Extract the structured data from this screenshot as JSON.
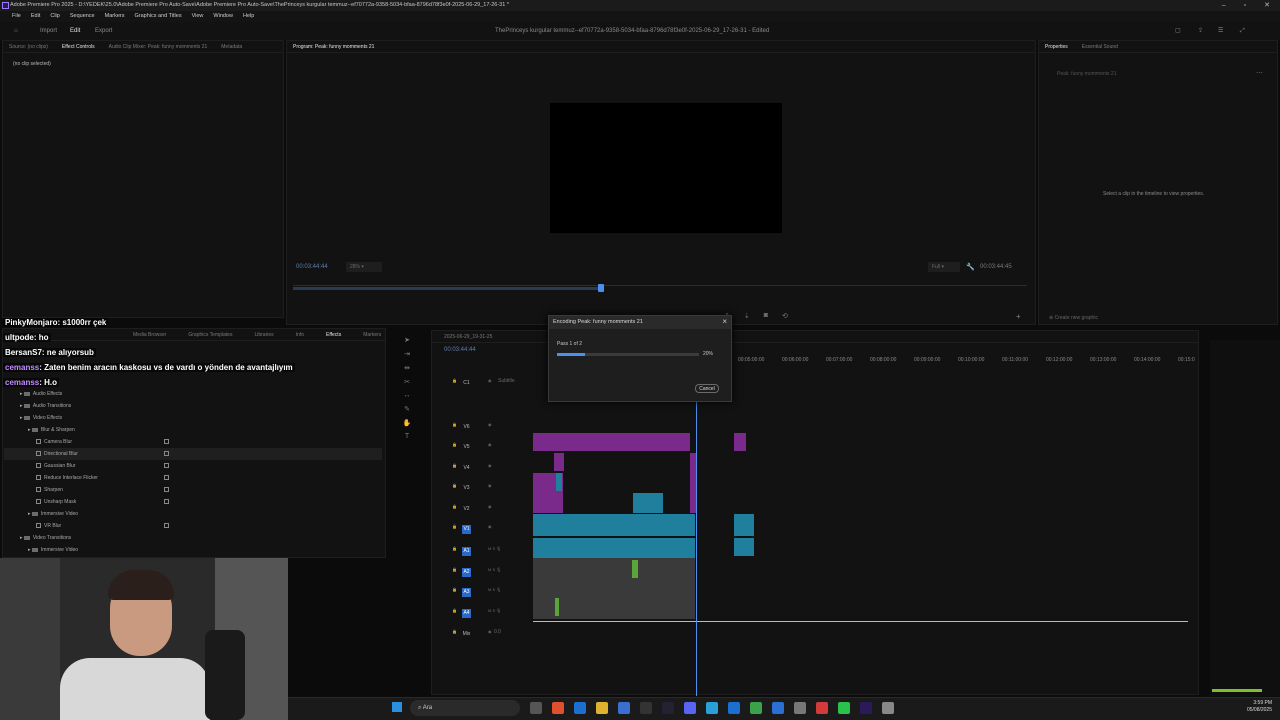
{
  "titlebar": {
    "title": "Adobe Premiere Pro 2025 - D:\\YEDEK\\25.0\\Adobe Premiere Pro Auto-Save\\Adobe Premiere Pro Auto-Save\\ThePrinceys kurgular temmuz--ef70772a-9358-5034-bfaa-8796d78f3e0f-2025-06-29_17-26-31 *"
  },
  "menu": [
    "File",
    "Edit",
    "Clip",
    "Sequence",
    "Markers",
    "Graphics and Titles",
    "View",
    "Window",
    "Help"
  ],
  "workspace": {
    "tabs": [
      "Import",
      "Edit",
      "Export"
    ],
    "active": "Edit",
    "project_title": "ThePrinceys kurgular temmuz--ef70772a-9358-5034-bfaa-8796d78f3e0f-2025-06-29_17-26-31 - Edited"
  },
  "source_panel": {
    "tabs": [
      "Source: (no clips)",
      "Effect Controls",
      "Audio Clip Mixer: Peak: funny momments 21",
      "Metadata"
    ],
    "active": "Effect Controls",
    "empty_text": "(no clip selected)"
  },
  "program_monitor": {
    "title": "Program: Peak: funny momments 21",
    "timecode_left": "00:03:44:44",
    "zoom": "28%",
    "quality": "Full",
    "timecode_right": "00:03:44:45",
    "scrub_progress": 0.42
  },
  "properties_panel": {
    "tabs": [
      "Properties",
      "Essential Sound"
    ],
    "active": "Properties",
    "clip_name": "Peak: funny momments 21",
    "empty_text": "Select a clip in the timeline to view properties.",
    "create_graphic": "Create new graphic"
  },
  "effects_panel": {
    "tabs": [
      "Media Browser",
      "Graphics Templates",
      "Libraries",
      "Info",
      "Effects",
      "Markers"
    ],
    "active": "Effects",
    "tree": [
      {
        "label": "Audio Effects",
        "type": "folder",
        "level": 1
      },
      {
        "label": "Audio Transitions",
        "type": "folder",
        "level": 1
      },
      {
        "label": "Video Effects",
        "type": "folder",
        "level": 1
      },
      {
        "label": "Blur & Sharpen",
        "type": "folder",
        "level": 2
      },
      {
        "label": "Camera Blur",
        "type": "effect",
        "level": 3
      },
      {
        "label": "Directional Blur",
        "type": "effect",
        "level": 3,
        "selected": true
      },
      {
        "label": "Gaussian Blur",
        "type": "effect",
        "level": 3
      },
      {
        "label": "Reduce Interlace Flicker",
        "type": "effect",
        "level": 3
      },
      {
        "label": "Sharpen",
        "type": "effect",
        "level": 3
      },
      {
        "label": "Unsharp Mask",
        "type": "effect",
        "level": 3
      },
      {
        "label": "Immersive Video",
        "type": "folder",
        "level": 2
      },
      {
        "label": "VR Blur",
        "type": "effect",
        "level": 3
      },
      {
        "label": "Video Transitions",
        "type": "folder",
        "level": 1
      },
      {
        "label": "Immersive Video",
        "type": "folder",
        "level": 2
      }
    ]
  },
  "chat": [
    {
      "name": "PinkyMonjaro",
      "message": ": s1000rr çek",
      "color": "white"
    },
    {
      "name": "ultpode",
      "message": ": ho",
      "color": "white"
    },
    {
      "name": "BersanS7",
      "message": ": ne alıyorsub",
      "color": "white"
    },
    {
      "name": "cemanss",
      "message": ": Zaten benim aracın kaskosu vs de vardı o yönden de avantajlıyım",
      "color": "purple"
    },
    {
      "name": "cemanss",
      "message": ": H.o",
      "color": "purple"
    }
  ],
  "timeline": {
    "tab": "2025-06-29_19-31-25",
    "timecode": "00:03:44:44",
    "ruler": [
      "00:05:00:00",
      "00:06:00:00",
      "00:07:00:00",
      "00:08:00:00",
      "00:09:00:00",
      "00:10:00:00",
      "00:11:00:00",
      "00:12:00:00",
      "00:13:00:00",
      "00:14:00:00",
      "00:15:0"
    ],
    "tracks": [
      "C1",
      "V6",
      "V5",
      "V4",
      "V3",
      "V2",
      "V1",
      "A1",
      "A2",
      "A3",
      "A4",
      "Mix"
    ],
    "subtitle_label": "Subtitle",
    "mix_value": "0.0"
  },
  "encoding_dialog": {
    "title": "Encoding Peak: funny momments 21",
    "pass": "Pass 1 of 2",
    "progress": 0.2,
    "percent_label": "20%",
    "cancel": "Cancel"
  },
  "taskbar": {
    "search": "Ara",
    "time": "3:59 PM",
    "date": "05/08/2025"
  },
  "colors": {
    "accent": "#4b8ff0",
    "video_clip": "#7a2a8a",
    "audio_clip": "#1f7f9c",
    "track_selected": "#2b69c9"
  }
}
